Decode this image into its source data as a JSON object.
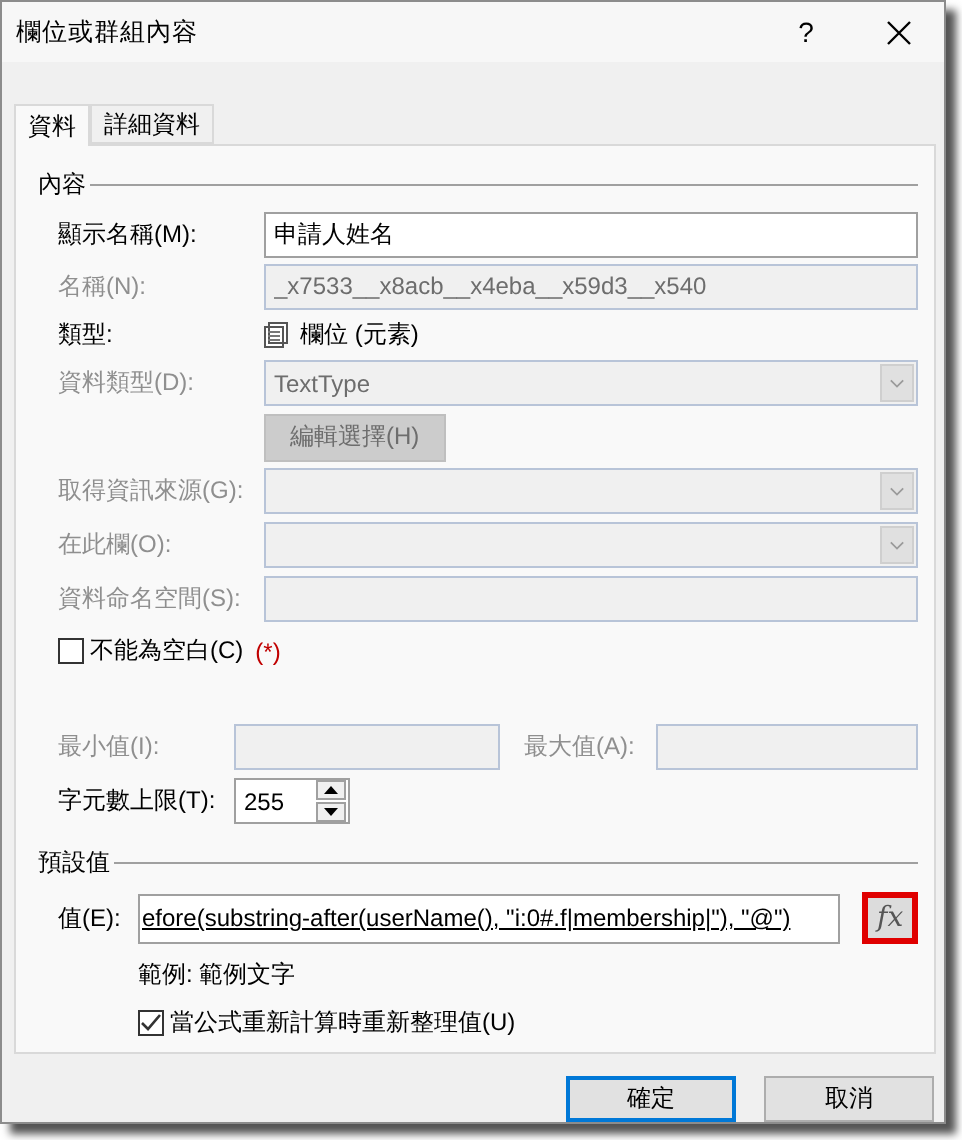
{
  "window": {
    "title": "欄位或群組內容",
    "help": "?"
  },
  "tabs": [
    {
      "label": "資料",
      "selected": true
    },
    {
      "label": "詳細資料",
      "selected": false
    }
  ],
  "content": {
    "heading": "內容",
    "display_name": {
      "label": "顯示名稱(M):",
      "value": "申請人姓名",
      "disabled": false
    },
    "name": {
      "label": "名稱(N):",
      "value": "_x7533__x8acb__x4eba__x59d3__x540",
      "disabled": true
    },
    "type": {
      "label": "類型:",
      "value": "欄位 (元素)"
    },
    "data_type": {
      "label": "資料類型(D):",
      "value": "TextType",
      "disabled": true
    },
    "edit_choices_button": {
      "label": "編輯選擇(H)",
      "disabled": true
    },
    "get_info_from": {
      "label": "取得資訊來源(G):",
      "disabled": true
    },
    "in_this_field": {
      "label": "在此欄(O):",
      "disabled": true
    },
    "namespace": {
      "label": "資料命名空間(S):",
      "disabled": true
    },
    "cannot_be_blank": {
      "label": "不能為空白(C)",
      "marker": "(*)",
      "checked": false
    },
    "min": {
      "label": "最小值(I):",
      "disabled": true
    },
    "max": {
      "label": "最大值(A):",
      "disabled": true
    },
    "max_chars": {
      "label": "字元數上限(T):",
      "value": "255"
    }
  },
  "default": {
    "heading": "預設值",
    "value": {
      "label": "值(E):",
      "value": "efore(substring-after(userName(), \"i:0#.f|membership|\"), \"@\")"
    },
    "formula_button": {
      "label": "fx",
      "highlighted": true
    },
    "example": "範例: 範例文字",
    "refresh": {
      "label": "當公式重新計算時重新整理值(U)",
      "checked": true
    }
  },
  "buttons": [
    {
      "label": "確定",
      "default": true
    },
    {
      "label": "取消",
      "default": false
    }
  ]
}
